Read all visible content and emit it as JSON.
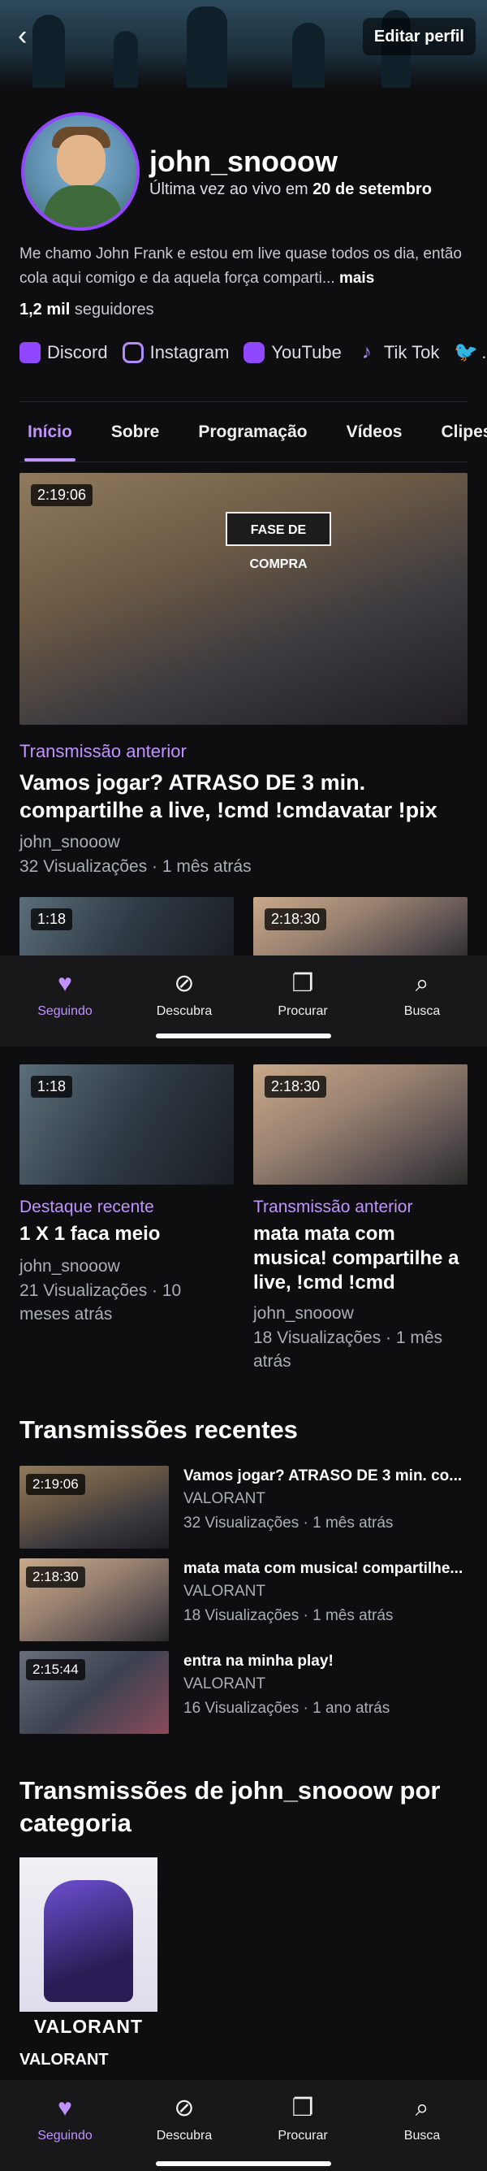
{
  "header": {
    "edit_profile": "Editar perfil"
  },
  "profile": {
    "username": "john_snooow",
    "last_live_prefix": "Última vez ao vivo em",
    "last_live_date": "20 de setembro",
    "bio": "Me chamo John Frank e estou em live quase todos os dia, então cola aqui comigo e da aquela força comparti...",
    "bio_more": "mais",
    "followers_count": "1,2 mil",
    "followers_label": "seguidores"
  },
  "socials": [
    {
      "label": "Discord",
      "icon": "discord-icon"
    },
    {
      "label": "Instagram",
      "icon": "instagram-icon"
    },
    {
      "label": "YouTube",
      "icon": "youtube-icon"
    },
    {
      "label": "Tik Tok",
      "icon": "tiktok-icon"
    },
    {
      "label": "..",
      "icon": "twitter-icon"
    }
  ],
  "tabs": [
    "Início",
    "Sobre",
    "Programação",
    "Vídeos",
    "Clipes"
  ],
  "featured": {
    "duration": "2:19:06",
    "overlay": "FASE DE COMPRA",
    "category": "Transmissão anterior",
    "title": "Vamos jogar? ATRASO DE 3 min. compartilhe a live, !cmd !cmdavatar !pix",
    "channel": "john_snooow",
    "meta": "32 Visualizações · 1 mês atrás"
  },
  "peek": [
    {
      "duration": "1:18"
    },
    {
      "duration": "2:18:30"
    }
  ],
  "nav": {
    "following": "Seguindo",
    "discover": "Descubra",
    "browse": "Procurar",
    "search": "Busca"
  },
  "cards": [
    {
      "duration": "1:18",
      "category": "Destaque recente",
      "title": "1 X 1 faca meio",
      "channel": "john_snooow",
      "meta": "21 Visualizações · 10 meses atrás"
    },
    {
      "duration": "2:18:30",
      "category": "Transmissão anterior",
      "title": "mata mata com musica! compartilhe a live, !cmd !cmd",
      "channel": "john_snooow",
      "meta": "18 Visualizações · 1 mês atrás"
    }
  ],
  "recent": {
    "section_title": "Transmissões recentes",
    "items": [
      {
        "duration": "2:19:06",
        "title": "Vamos jogar? ATRASO DE 3 min. co...",
        "game": "VALORANT",
        "meta": "32 Visualizações · 1 mês atrás"
      },
      {
        "duration": "2:18:30",
        "title": "mata mata com musica! compartilhe...",
        "game": "VALORANT",
        "meta": "18 Visualizações · 1 mês atrás"
      },
      {
        "duration": "2:15:44",
        "title": "entra na minha play!",
        "game": "VALORANT",
        "meta": "16 Visualizações · 1 ano atrás"
      }
    ]
  },
  "categories": {
    "section_title": "Transmissões de john_snooow por categoria",
    "items": [
      {
        "name": "VALORANT",
        "logo": "VALORANT"
      }
    ]
  }
}
